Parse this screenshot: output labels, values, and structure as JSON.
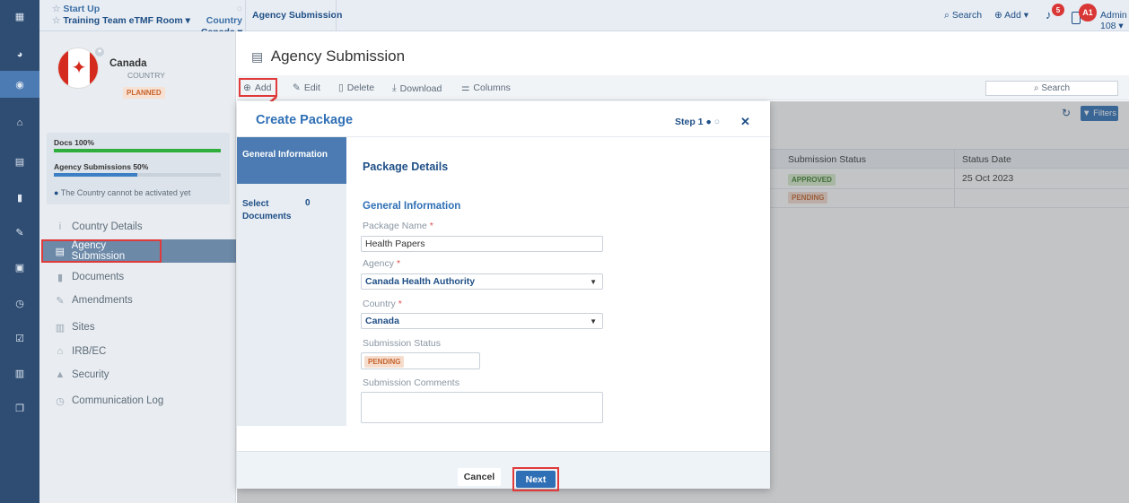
{
  "topbar": {
    "crumb1_top": "Start Up",
    "crumb1_bottom": "Training Team eTMF Room ▾",
    "crumb2_top": "Country",
    "crumb2_bottom": "Canada ▾",
    "crumb3": "Agency Submission",
    "search_label": "Search",
    "add_label": "Add ▾",
    "notif_count": "5",
    "avatar_initials": "A1",
    "user_label": "Admin 108 ▾"
  },
  "country": {
    "name": "Canada",
    "type": "COUNTRY",
    "status": "PLANNED",
    "docs_label": "Docs 100%",
    "docs_progress": 1.0,
    "agency_label": "Agency Submissions 50%",
    "agency_progress": 0.5,
    "notice": "The Country cannot be activated yet"
  },
  "sidebar": {
    "items": [
      {
        "label": "Country Details",
        "icon": "info-icon"
      },
      {
        "label": "Agency Submission",
        "icon": "list-icon"
      },
      {
        "label": "Documents",
        "icon": "file-icon"
      },
      {
        "label": "Amendments",
        "icon": "edit-icon"
      },
      {
        "label": "Sites",
        "icon": "building-icon"
      },
      {
        "label": "IRB/EC",
        "icon": "bank-icon"
      },
      {
        "label": "Security",
        "icon": "lock-icon"
      },
      {
        "label": "Communication Log",
        "icon": "clock-icon"
      }
    ]
  },
  "main": {
    "title": "Agency Submission",
    "toolbar": {
      "add": "Add",
      "edit": "Edit",
      "delete": "Delete",
      "download": "Download",
      "columns": "Columns",
      "search_placeholder": "Search",
      "filters": "Filters"
    },
    "table": {
      "headers": [
        "Submission Status",
        "Status Date"
      ],
      "rows": [
        {
          "status": "APPROVED",
          "date": "25 Oct 2023"
        },
        {
          "status": "PENDING",
          "date": ""
        }
      ]
    }
  },
  "modal": {
    "title": "Create Package",
    "step_label": "Step 1",
    "steps": [
      {
        "label": "General Information"
      },
      {
        "label": "Select Documents",
        "count": "0"
      }
    ],
    "section_title": "Package Details",
    "subsection_title": "General Information",
    "fields": {
      "package_name_label": "Package Name",
      "package_name_value": "Health Papers",
      "agency_label": "Agency",
      "agency_value": "Canada Health Authority",
      "country_label": "Country",
      "country_value": "Canada",
      "status_label": "Submission Status",
      "status_value": "PENDING",
      "comments_label": "Submission Comments",
      "required_mark": "*"
    },
    "cancel": "Cancel",
    "next": "Next"
  },
  "colors": {
    "accent": "#2f6fb5",
    "rail": "#2f4d73",
    "highlight": "#e03a3a",
    "approved_bg": "#d7ecc9",
    "pending_bg": "#f5dccc"
  }
}
